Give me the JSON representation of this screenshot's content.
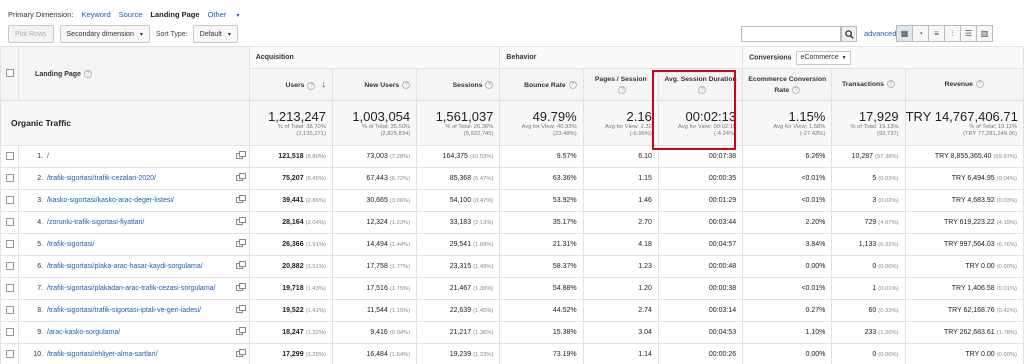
{
  "primary_dimension": {
    "label": "Primary Dimension:",
    "options": [
      "Keyword",
      "Source",
      "Landing Page",
      "Other"
    ],
    "active": "Landing Page"
  },
  "toolbar": {
    "plot_rows": "Plot Rows",
    "secondary_dimension": "Secondary dimension",
    "sort_type_label": "Sort Type:",
    "sort_type_value": "Default",
    "advanced": "advanced"
  },
  "table": {
    "groups": {
      "acquisition": "Acquisition",
      "behavior": "Behavior",
      "conversions": "Conversions",
      "conversions_select": "eCommerce"
    },
    "headers": {
      "landing_page": "Landing Page",
      "users": "Users",
      "new_users": "New Users",
      "sessions": "Sessions",
      "bounce_rate": "Bounce Rate",
      "pages_session": "Pages / Session",
      "avg_duration": "Avg. Session Duration",
      "ecom_rate": "Ecommerce Conversion Rate",
      "transactions": "Transactions",
      "revenue": "Revenue"
    },
    "totals": {
      "label": "Organic Traffic",
      "users": {
        "v": "1,213,247",
        "s1": "% of Total: 38.70%",
        "s2": "(3,135,271)"
      },
      "new_users": {
        "v": "1,003,054",
        "s1": "% of Total: 35.50%",
        "s2": "(2,825,834)"
      },
      "sessions": {
        "v": "1,561,037",
        "s1": "% of Total: 26.36%",
        "s2": "(5,922,745)"
      },
      "bounce_rate": {
        "v": "49.79%",
        "s1": "Avg for View: 40.33%",
        "s2": "(23.48%)"
      },
      "pages_session": {
        "v": "2.16",
        "s1": "Avg for View: 2.32",
        "s2": "(-6.96%)"
      },
      "avg_duration": {
        "v": "00:02:13",
        "s1": "Avg for View: 00:02:19",
        "s2": "(-4.24%)"
      },
      "ecom_rate": {
        "v": "1.15%",
        "s1": "Avg for View: 1.58%",
        "s2": "(-27.43%)"
      },
      "transactions": {
        "v": "17,929",
        "s1": "% of Total: 19.13%",
        "s2": "(93,737)"
      },
      "revenue": {
        "v": "TRY 14,767,406.71",
        "s1": "% of Total: 19.11%",
        "s2": "(TRY 77,281,249.96)"
      }
    },
    "rows": [
      {
        "idx": "1.",
        "page": "/",
        "users": "121,518",
        "users_pct": "(8.80%)",
        "new_users": "73,003",
        "new_users_pct": "(7.28%)",
        "sessions": "164,375",
        "sessions_pct": "(10.53%)",
        "bounce": "9.57%",
        "pps": "6.10",
        "dur": "00:07:38",
        "ecr": "6.26%",
        "tx": "10,287",
        "tx_pct": "(57.38%)",
        "rev": "TRY 8,855,365.40",
        "rev_pct": "(59.97%)"
      },
      {
        "idx": "2.",
        "page": "/trafik-sigortasi/trafik-cezalari-2020/",
        "users": "75,207",
        "users_pct": "(5.45%)",
        "new_users": "67,443",
        "new_users_pct": "(6.72%)",
        "sessions": "85,368",
        "sessions_pct": "(5.47%)",
        "bounce": "63.36%",
        "pps": "1.15",
        "dur": "00:00:35",
        "ecr": "<0.01%",
        "tx": "5",
        "tx_pct": "(0.03%)",
        "rev": "TRY 6,494.95",
        "rev_pct": "(0.04%)"
      },
      {
        "idx": "3.",
        "page": "/kasko-sigortasi/kasko-arac-deger-listesi/",
        "users": "39,441",
        "users_pct": "(2.86%)",
        "new_users": "30,665",
        "new_users_pct": "(3.06%)",
        "sessions": "54,100",
        "sessions_pct": "(3.47%)",
        "bounce": "53.92%",
        "pps": "1.46",
        "dur": "00:01:29",
        "ecr": "<0.01%",
        "tx": "3",
        "tx_pct": "(0.02%)",
        "rev": "TRY 4,683.92",
        "rev_pct": "(0.03%)"
      },
      {
        "idx": "4.",
        "page": "/zorunlu-trafik-sigortasi-fiyatlari/",
        "users": "28,164",
        "users_pct": "(2.04%)",
        "new_users": "12,324",
        "new_users_pct": "(1.23%)",
        "sessions": "33,183",
        "sessions_pct": "(2.13%)",
        "bounce": "35.17%",
        "pps": "2.70",
        "dur": "00:03:44",
        "ecr": "2.20%",
        "tx": "729",
        "tx_pct": "(4.07%)",
        "rev": "TRY 619,223.22",
        "rev_pct": "(4.19%)"
      },
      {
        "idx": "5.",
        "page": "/trafik-sigortasi/",
        "users": "26,366",
        "users_pct": "(1.91%)",
        "new_users": "14,494",
        "new_users_pct": "(1.44%)",
        "sessions": "29,541",
        "sessions_pct": "(1.89%)",
        "bounce": "21.31%",
        "pps": "4.18",
        "dur": "00:04:57",
        "ecr": "3.84%",
        "tx": "1,133",
        "tx_pct": "(6.32%)",
        "rev": "TRY 997,564.03",
        "rev_pct": "(6.76%)"
      },
      {
        "idx": "6.",
        "page": "/trafik-sigortasi/plaka-arac-hasar-kaydi-sorgulama/",
        "users": "20,882",
        "users_pct": "(1.51%)",
        "new_users": "17,758",
        "new_users_pct": "(1.77%)",
        "sessions": "23,315",
        "sessions_pct": "(1.49%)",
        "bounce": "58.37%",
        "pps": "1.23",
        "dur": "00:00:48",
        "ecr": "0.00%",
        "tx": "0",
        "tx_pct": "(0.00%)",
        "rev": "TRY 0.00",
        "rev_pct": "(0.00%)"
      },
      {
        "idx": "7.",
        "page": "/trafik-sigortasi/plakadan-arac-trafik-cezasi-sorgulama/",
        "users": "19,718",
        "users_pct": "(1.43%)",
        "new_users": "17,516",
        "new_users_pct": "(1.75%)",
        "sessions": "21,467",
        "sessions_pct": "(1.38%)",
        "bounce": "54.88%",
        "pps": "1.20",
        "dur": "00:00:38",
        "ecr": "<0.01%",
        "tx": "1",
        "tx_pct": "(0.01%)",
        "rev": "TRY 1,406.58",
        "rev_pct": "(0.01%)"
      },
      {
        "idx": "8.",
        "page": "/trafik-sigortasi/trafik-sigortasi-iptali-ve-geri-iadesi/",
        "users": "19,522",
        "users_pct": "(1.41%)",
        "new_users": "11,544",
        "new_users_pct": "(1.15%)",
        "sessions": "22,639",
        "sessions_pct": "(1.45%)",
        "bounce": "44.52%",
        "pps": "2.74",
        "dur": "00:03:14",
        "ecr": "0.27%",
        "tx": "60",
        "tx_pct": "(0.33%)",
        "rev": "TRY 62,168.76",
        "rev_pct": "(0.42%)"
      },
      {
        "idx": "9.",
        "page": "/arac-kasko-sorgulama/",
        "users": "18,247",
        "users_pct": "(1.32%)",
        "new_users": "9,416",
        "new_users_pct": "(0.94%)",
        "sessions": "21,217",
        "sessions_pct": "(1.36%)",
        "bounce": "15.38%",
        "pps": "3.04",
        "dur": "00:04:53",
        "ecr": "1.10%",
        "tx": "233",
        "tx_pct": "(1.30%)",
        "rev": "TRY 262,683.61",
        "rev_pct": "(1.78%)"
      },
      {
        "idx": "10.",
        "page": "/trafik-sigortasi/ehliyet-alma-sartlari/",
        "users": "17,299",
        "users_pct": "(1.25%)",
        "new_users": "16,484",
        "new_users_pct": "(1.64%)",
        "sessions": "19,239",
        "sessions_pct": "(1.23%)",
        "bounce": "73.19%",
        "pps": "1.14",
        "dur": "00:00:26",
        "ecr": "0.00%",
        "tx": "0",
        "tx_pct": "(0.00%)",
        "rev": "TRY 0.00",
        "rev_pct": "(0.00%)"
      }
    ]
  },
  "colors": {
    "link": "#1a5fb4",
    "highlight": "#d0021b"
  }
}
